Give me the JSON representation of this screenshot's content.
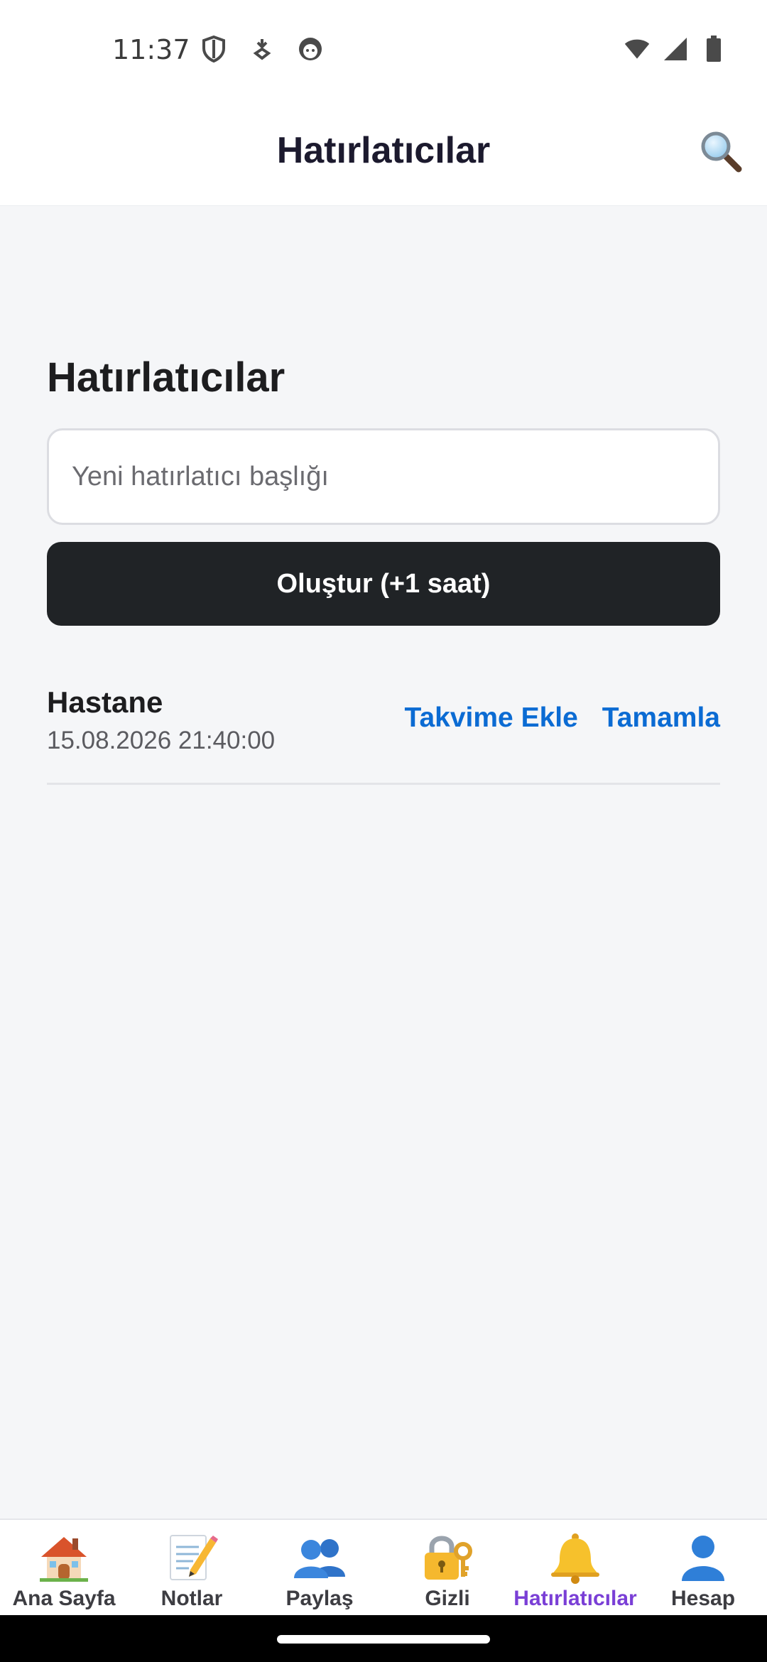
{
  "status_bar": {
    "time": "11:37",
    "left_icons": [
      "shield-icon",
      "download-icon",
      "face-icon"
    ],
    "right_icons": [
      "wifi-icon",
      "signal-icon",
      "battery-icon"
    ]
  },
  "app_bar": {
    "title": "Hatırlatıcılar",
    "search_icon": "magnifier-icon"
  },
  "main": {
    "section_title": "Hatırlatıcılar",
    "new_input": {
      "placeholder": "Yeni hatırlatıcı başlığı",
      "value": ""
    },
    "create_button": "Oluştur (+1 saat)",
    "reminders": [
      {
        "title": "Hastane",
        "datetime": "15.08.2026 21:40:00",
        "actions": {
          "calendar": "Takvime Ekle",
          "complete": "Tamamla"
        }
      }
    ]
  },
  "bottom_nav": {
    "active": "Hatırlatıcılar",
    "items": [
      {
        "label": "Ana Sayfa",
        "icon": "house-icon"
      },
      {
        "label": "Notlar",
        "icon": "memo-icon"
      },
      {
        "label": "Paylaş",
        "icon": "people-icon"
      },
      {
        "label": "Gizli",
        "icon": "lock-icon"
      },
      {
        "label": "Hatırlatıcılar",
        "icon": "bell-icon"
      },
      {
        "label": "Hesap",
        "icon": "person-icon"
      }
    ]
  },
  "colors": {
    "accent_active": "#7a3fd6",
    "link": "#0b6bd3",
    "button_dark": "#202326",
    "background": "#f5f6f8"
  }
}
